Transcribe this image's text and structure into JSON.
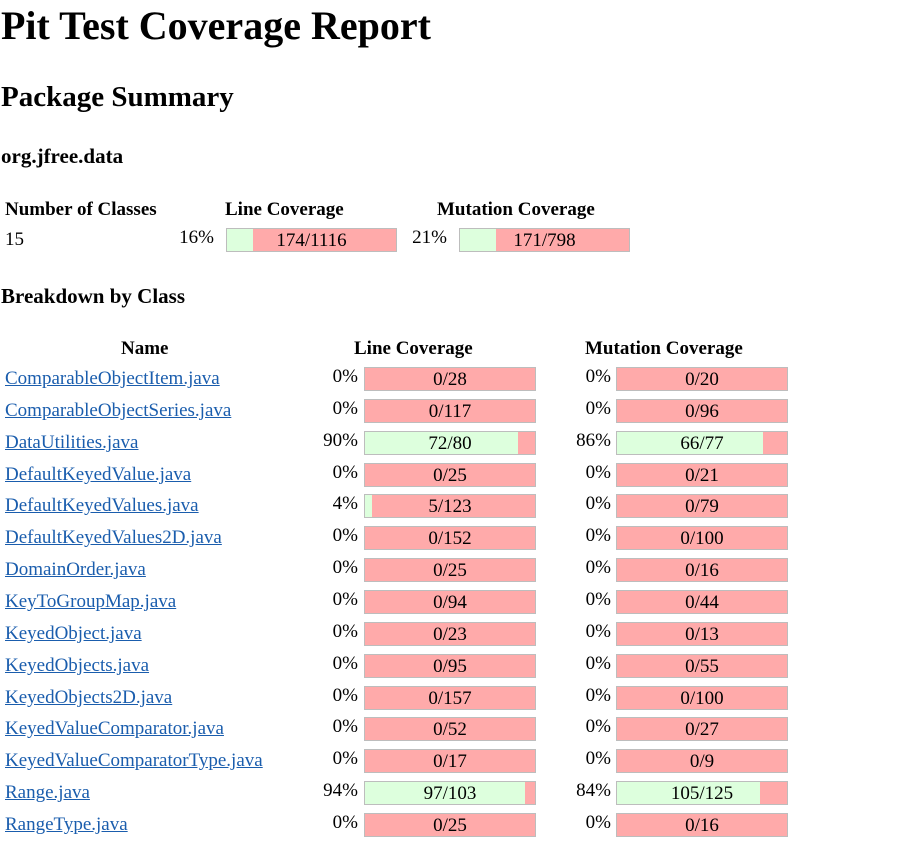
{
  "page": {
    "title": "Pit Test Coverage Report",
    "package_summary_heading": "Package Summary",
    "package_name": "org.jfree.data",
    "breakdown_heading": "Breakdown by Class"
  },
  "summary": {
    "headers": {
      "classes": "Number of Classes",
      "line": "Line Coverage",
      "mutation": "Mutation Coverage"
    },
    "classes": "15",
    "line": {
      "pct": "16%",
      "ratio": "174/1116",
      "fraction": 0.156
    },
    "mutation": {
      "pct": "21%",
      "ratio": "171/798",
      "fraction": 0.214
    }
  },
  "breakdown": {
    "headers": {
      "name": "Name",
      "line": "Line Coverage",
      "mutation": "Mutation Coverage"
    },
    "rows": [
      {
        "name": "ComparableObjectItem.java",
        "line_pct": "0%",
        "line_ratio": "0/28",
        "line_frac": 0,
        "mut_pct": "0%",
        "mut_ratio": "0/20",
        "mut_frac": 0
      },
      {
        "name": "ComparableObjectSeries.java",
        "line_pct": "0%",
        "line_ratio": "0/117",
        "line_frac": 0,
        "mut_pct": "0%",
        "mut_ratio": "0/96",
        "mut_frac": 0
      },
      {
        "name": "DataUtilities.java",
        "line_pct": "90%",
        "line_ratio": "72/80",
        "line_frac": 0.9,
        "mut_pct": "86%",
        "mut_ratio": "66/77",
        "mut_frac": 0.857
      },
      {
        "name": "DefaultKeyedValue.java",
        "line_pct": "0%",
        "line_ratio": "0/25",
        "line_frac": 0,
        "mut_pct": "0%",
        "mut_ratio": "0/21",
        "mut_frac": 0
      },
      {
        "name": "DefaultKeyedValues.java",
        "line_pct": "4%",
        "line_ratio": "5/123",
        "line_frac": 0.041,
        "mut_pct": "0%",
        "mut_ratio": "0/79",
        "mut_frac": 0
      },
      {
        "name": "DefaultKeyedValues2D.java",
        "line_pct": "0%",
        "line_ratio": "0/152",
        "line_frac": 0,
        "mut_pct": "0%",
        "mut_ratio": "0/100",
        "mut_frac": 0
      },
      {
        "name": "DomainOrder.java",
        "line_pct": "0%",
        "line_ratio": "0/25",
        "line_frac": 0,
        "mut_pct": "0%",
        "mut_ratio": "0/16",
        "mut_frac": 0
      },
      {
        "name": "KeyToGroupMap.java",
        "line_pct": "0%",
        "line_ratio": "0/94",
        "line_frac": 0,
        "mut_pct": "0%",
        "mut_ratio": "0/44",
        "mut_frac": 0
      },
      {
        "name": "KeyedObject.java",
        "line_pct": "0%",
        "line_ratio": "0/23",
        "line_frac": 0,
        "mut_pct": "0%",
        "mut_ratio": "0/13",
        "mut_frac": 0
      },
      {
        "name": "KeyedObjects.java",
        "line_pct": "0%",
        "line_ratio": "0/95",
        "line_frac": 0,
        "mut_pct": "0%",
        "mut_ratio": "0/55",
        "mut_frac": 0
      },
      {
        "name": "KeyedObjects2D.java",
        "line_pct": "0%",
        "line_ratio": "0/157",
        "line_frac": 0,
        "mut_pct": "0%",
        "mut_ratio": "0/100",
        "mut_frac": 0
      },
      {
        "name": "KeyedValueComparator.java",
        "line_pct": "0%",
        "line_ratio": "0/52",
        "line_frac": 0,
        "mut_pct": "0%",
        "mut_ratio": "0/27",
        "mut_frac": 0
      },
      {
        "name": "KeyedValueComparatorType.java",
        "line_pct": "0%",
        "line_ratio": "0/17",
        "line_frac": 0,
        "mut_pct": "0%",
        "mut_ratio": "0/9",
        "mut_frac": 0
      },
      {
        "name": "Range.java",
        "line_pct": "94%",
        "line_ratio": "97/103",
        "line_frac": 0.942,
        "mut_pct": "84%",
        "mut_ratio": "105/125",
        "mut_frac": 0.84
      },
      {
        "name": "RangeType.java",
        "line_pct": "0%",
        "line_ratio": "0/25",
        "line_frac": 0,
        "mut_pct": "0%",
        "mut_ratio": "0/16",
        "mut_frac": 0
      }
    ]
  },
  "colors": {
    "covered": "#ddffdd",
    "uncovered": "#ffaaaa",
    "link": "#1a5dad"
  }
}
